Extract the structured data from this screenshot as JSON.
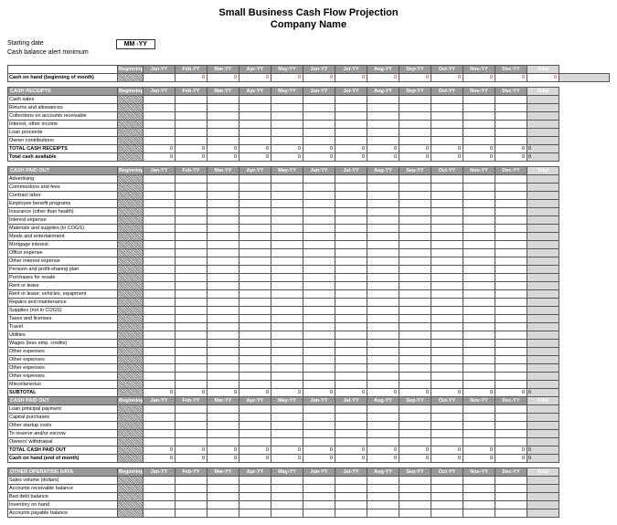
{
  "title": "Small Business Cash Flow Projection",
  "subtitle": "Company Name",
  "meta": {
    "starting_date_label": "Starting date",
    "starting_date_value": "MM -YY",
    "alert_label": "Cash balance alert minimum"
  },
  "months": [
    "Jan-YY",
    "Feb-YY",
    "Mar-YY",
    "Apr-YY",
    "May-YY",
    "Jun-YY",
    "Jul-YY",
    "Aug-YY",
    "Sep-YY",
    "Oct-YY",
    "Nov-YY",
    "Dec-YY"
  ],
  "beginning": "Beginning",
  "total": "Total",
  "cash_on_hand_begin": "Cash on hand (beginning of month)",
  "zero": "0",
  "sections": {
    "receipts": {
      "title": "CASH RECEIPTS",
      "rows": [
        "Cash sales",
        "Returns and allowances",
        "Collections on accounts receivable",
        "Interest, other income",
        "Loan proceeds",
        "Owner contributions"
      ],
      "total_row": "TOTAL CASH RECEIPTS",
      "available": "Total cash available"
    },
    "paidout": {
      "title": "CASH PAID OUT",
      "rows": [
        "Advertising",
        "Commissions and fees",
        "Contract labor",
        "Employee benefit programs",
        "Insurance (other than health)",
        "Interest expense",
        "Materials and supplies (in COGS)",
        "Meals and entertainment",
        "Mortgage interest",
        "Office expense",
        "Other interest expense",
        "Pension and profit-sharing plan",
        "Purchases for resale",
        "Rent or lease",
        "Rent or lease: vehicles, equipment",
        "Repairs and maintenance",
        "Supplies (not in COGS)",
        "Taxes and licenses",
        "Travel",
        "Utilities",
        "Wages (less emp. credits)",
        "Other expenses",
        "Other expenses",
        "Other expenses",
        "Other expenses",
        "Miscellaneous"
      ],
      "subtotal": "SUBTOTAL",
      "title2": "CASH PAID OUT",
      "rows2": [
        "Loan principal payment",
        "Capital purchases",
        "Other startup costs",
        "To reserve and/or escrow",
        "Owners' withdrawal"
      ],
      "total_row": "TOTAL CASH PAID OUT",
      "end": "Cash on hand (end of month)"
    },
    "other": {
      "title": "OTHER OPERATING DATA",
      "rows": [
        "Sales volume (dollars)",
        "Accounts receivable balance",
        "Bad debt balance",
        "Inventory on hand",
        "Accounts payable balance"
      ]
    }
  }
}
